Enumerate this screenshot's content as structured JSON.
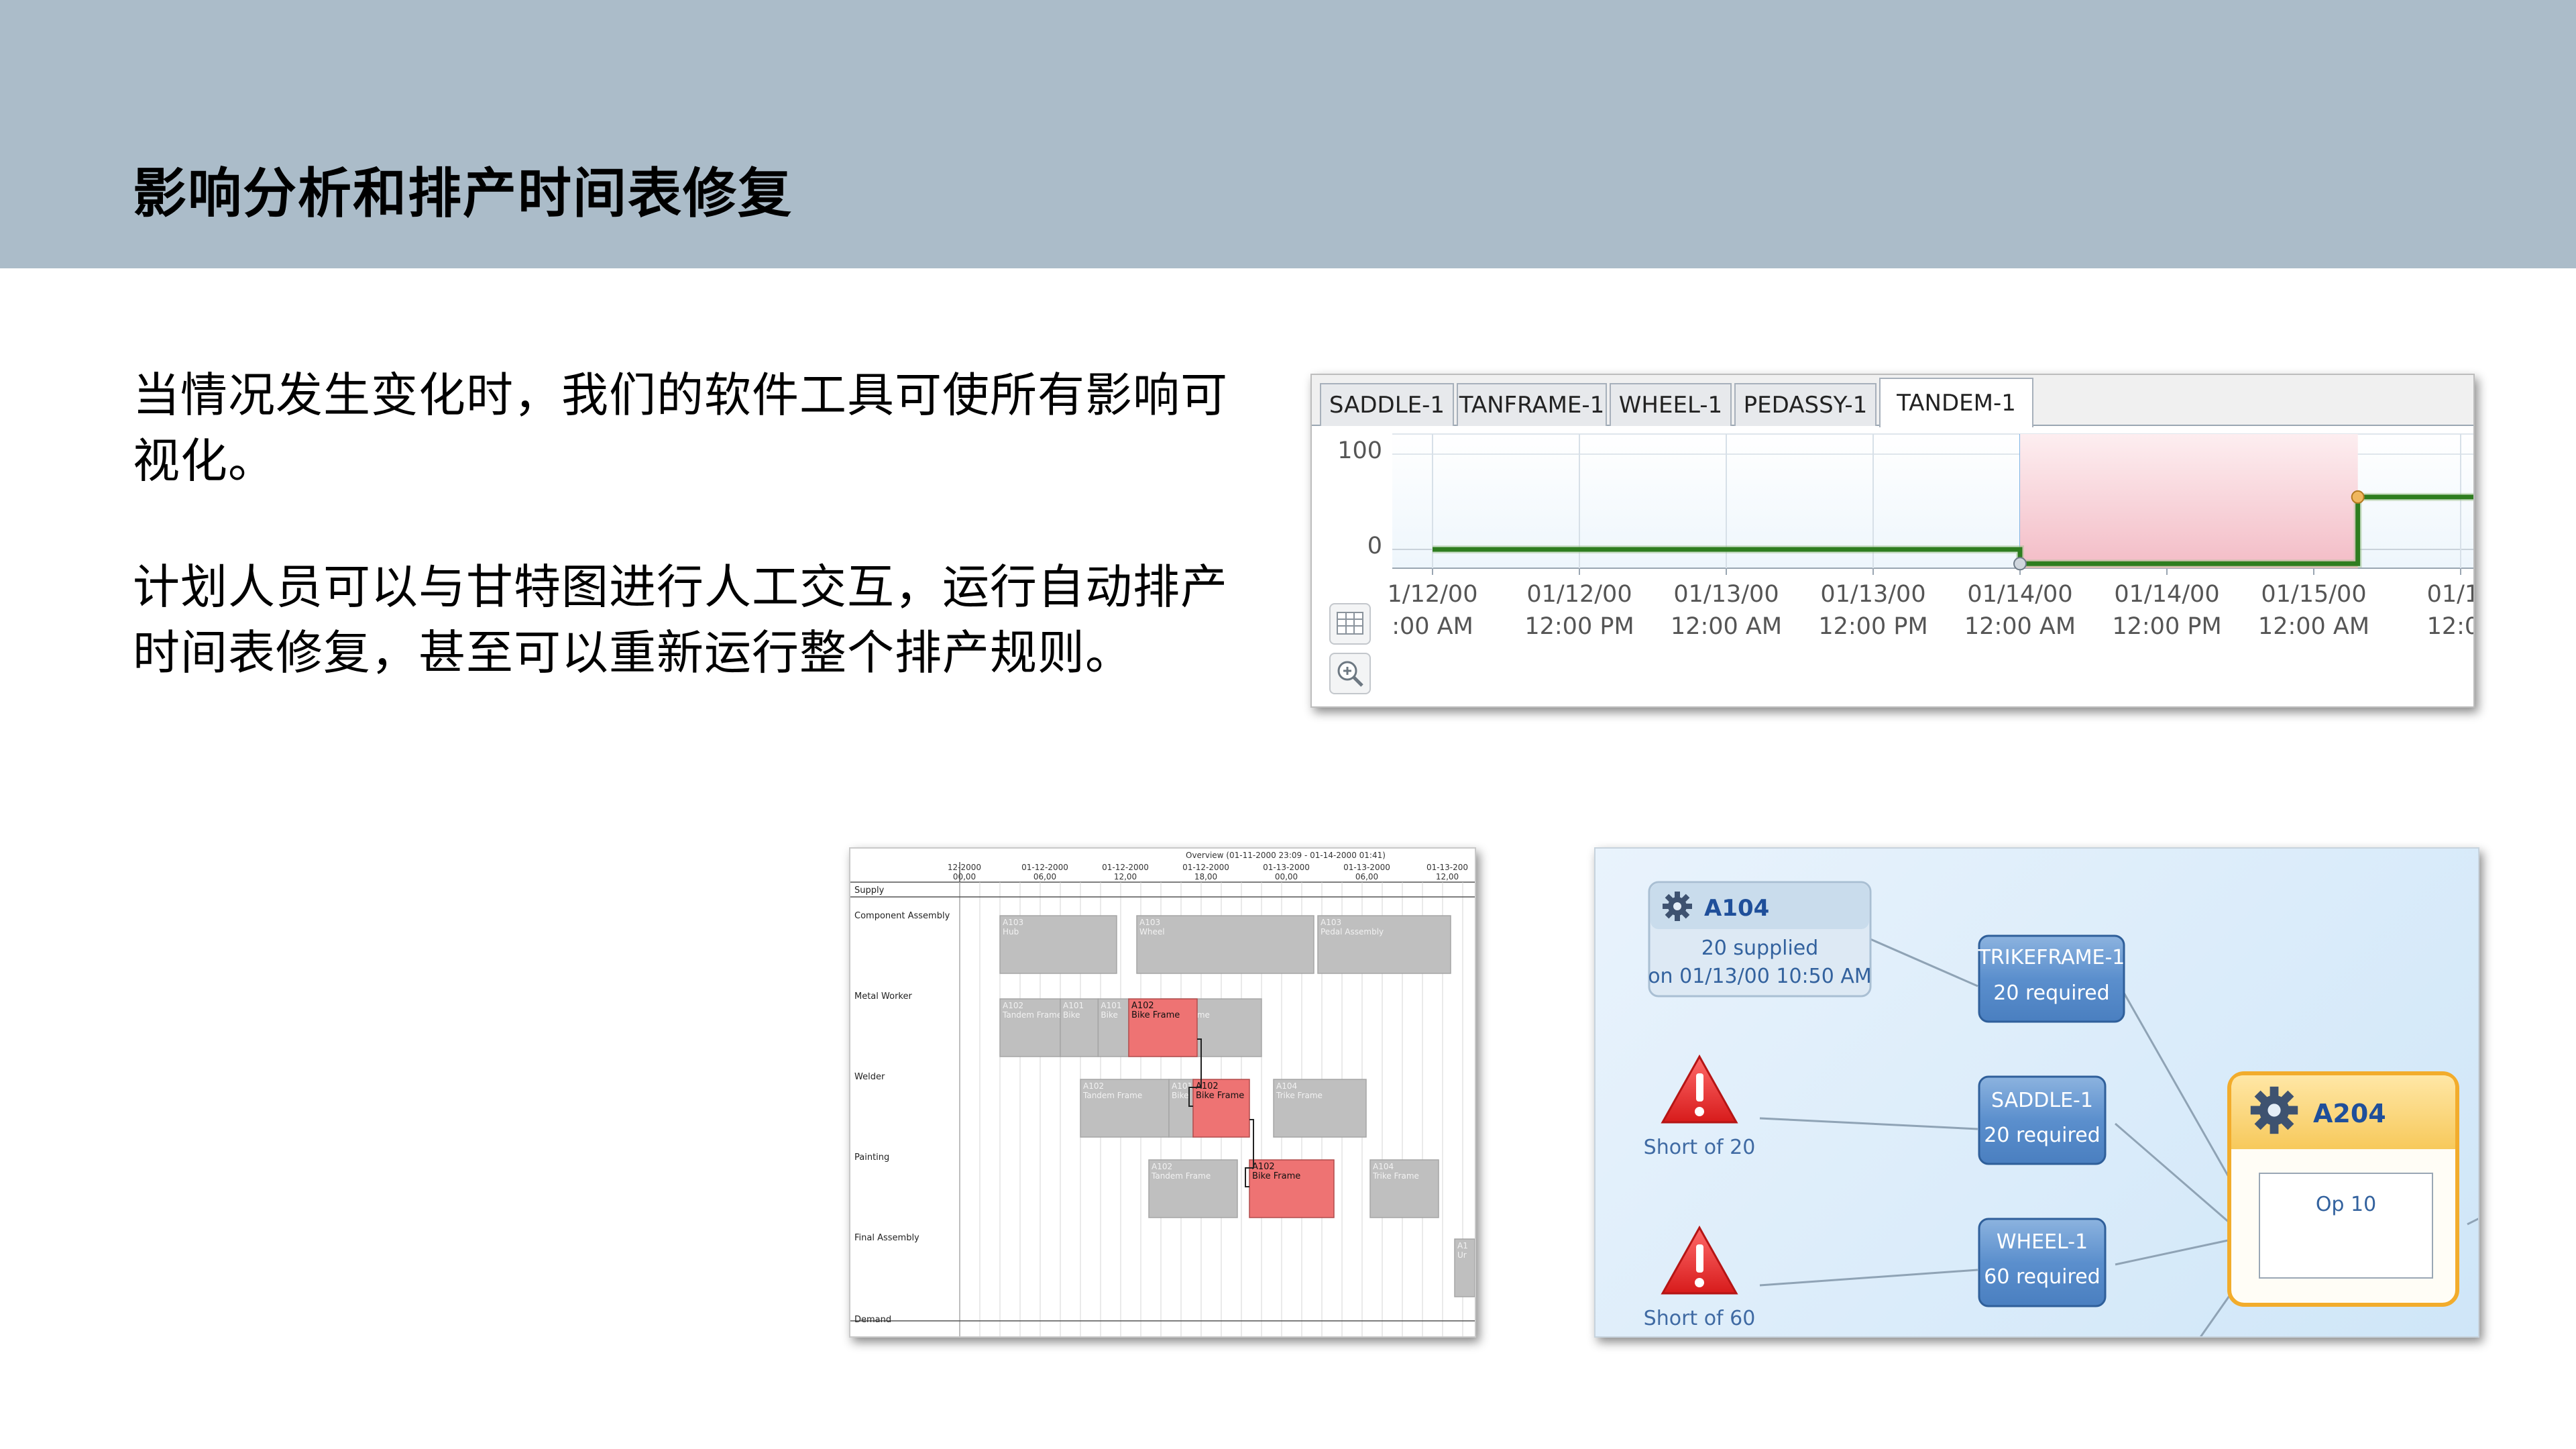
{
  "slide": {
    "title": "影响分析和排产时间表修复",
    "paragraph1_line1": "当情况发生变化时，我们的软件工具可使所有影响可",
    "paragraph1_line2": "视化。",
    "paragraph2_line1": "计划人员可以与甘特图进行人工交互，运行自动排产",
    "paragraph2_line2": "时间表修复，甚至可以重新运行整个排产规则。"
  },
  "inventory_panel": {
    "tabs": [
      {
        "label": "SADDLE-1",
        "active": false
      },
      {
        "label": "TANFRAME-1",
        "active": false
      },
      {
        "label": "WHEEL-1",
        "active": false
      },
      {
        "label": "PEDASSY-1",
        "active": false
      },
      {
        "label": "TANDEM-1",
        "active": true
      }
    ],
    "icons": {
      "table": "table-icon",
      "zoom": "zoom-icon"
    },
    "chart_data": {
      "type": "line",
      "y_ticks": [
        "100",
        "0"
      ],
      "x_ticks": [
        {
          "date": "1/12/00",
          "time": ":00 AM"
        },
        {
          "date": "01/12/00",
          "time": "12:00 PM"
        },
        {
          "date": "01/13/00",
          "time": "12:00 AM"
        },
        {
          "date": "01/13/00",
          "time": "12:00 PM"
        },
        {
          "date": "01/14/00",
          "time": "12:00 AM"
        },
        {
          "date": "01/14/00",
          "time": "12:00 PM"
        },
        {
          "date": "01/15/00",
          "time": "12:00 AM"
        },
        {
          "date": "01/15",
          "time": "12:00"
        }
      ],
      "series": [
        {
          "points": [
            [
              0,
              0
            ],
            [
              4,
              0
            ],
            [
              4,
              -15
            ],
            [
              6.3,
              -15
            ],
            [
              6.3,
              55
            ],
            [
              7.5,
              55
            ]
          ]
        }
      ],
      "shortage_region": [
        4,
        6.3
      ],
      "colors": {
        "line": "#2e7d1f",
        "shortage": "#f4c5cc",
        "marker": "#f0b75e"
      }
    }
  },
  "gantt_panel": {
    "overview_line1": "Overview   (01-11-2000 23:09 - 01-14-2000 01:41)",
    "axis_labels": [
      {
        "date": "12-2000",
        "time": "00,00"
      },
      {
        "date": "01-12-2000",
        "time": "06,00"
      },
      {
        "date": "01-12-2000",
        "time": "12,00"
      },
      {
        "date": "01-12-2000",
        "time": "18,00"
      },
      {
        "date": "01-13-2000",
        "time": "00,00"
      },
      {
        "date": "01-13-2000",
        "time": "06,00"
      },
      {
        "date": "01-13-200",
        "time": "12,00"
      }
    ],
    "lanes": [
      "Supply",
      "Component Assembly",
      "Metal Worker",
      "Welder",
      "Painting",
      "Final Assembly",
      "Demand"
    ],
    "bars": [
      {
        "lane": 1,
        "t0": 0.5,
        "t1": 1.95,
        "id": "A103",
        "label": "Hub"
      },
      {
        "lane": 1,
        "t0": 2.2,
        "t1": 4.4,
        "id": "A103",
        "label": "Wheel"
      },
      {
        "lane": 1,
        "t0": 4.45,
        "t1": 6.1,
        "id": "A103",
        "label": "Pedal Assembly"
      },
      {
        "lane": 2,
        "t0": 0.5,
        "t1": 1.25,
        "id": "A102",
        "label": "Tandem Frame"
      },
      {
        "lane": 2,
        "t0": 1.25,
        "t1": 1.72,
        "id": "A101",
        "label": "Bike"
      },
      {
        "lane": 2,
        "t0": 1.72,
        "t1": 2.1,
        "id": "A101",
        "label": "Bike"
      },
      {
        "lane": 2,
        "t0": 2.5,
        "t1": 3.75,
        "id": "A104",
        "label": "Trike Frame"
      },
      {
        "lane": 3,
        "t0": 1.5,
        "t1": 2.6,
        "id": "A102",
        "label": "Tandem Frame"
      },
      {
        "lane": 3,
        "t0": 2.6,
        "t1": 2.9,
        "id": "A101",
        "label": "Bike"
      },
      {
        "lane": 3,
        "t0": 3.9,
        "t1": 5.05,
        "id": "A104",
        "label": "Trike Frame"
      },
      {
        "lane": 4,
        "t0": 2.35,
        "t1": 3.45,
        "id": "A102",
        "label": "Tandem Frame"
      },
      {
        "lane": 4,
        "t0": 5.1,
        "t1": 5.95,
        "id": "A104",
        "label": "Trike Frame"
      },
      {
        "lane": 5,
        "t0": 6.15,
        "t1": 6.4,
        "id": "A1",
        "label": "Ur"
      }
    ],
    "highlight_bars": [
      {
        "lane": 2,
        "t0": 2.1,
        "t1": 2.95,
        "id": "A102",
        "label": "Bike Frame"
      },
      {
        "lane": 3,
        "t0": 2.9,
        "t1": 3.6,
        "id": "A102",
        "label": "Bike Frame"
      },
      {
        "lane": 4,
        "t0": 3.6,
        "t1": 4.65,
        "id": "A102",
        "label": "Bike Frame"
      }
    ]
  },
  "network_panel": {
    "supply_node": {
      "id": "A104",
      "line1": "20 supplied",
      "line2": "on 01/13/00 10:50 AM",
      "icon": "gear-icon"
    },
    "requirements": [
      {
        "name": "TRIKEFRAME-1",
        "qty": "20 required"
      },
      {
        "name": "SADDLE-1",
        "qty": "20 required"
      },
      {
        "name": "WHEEL-1",
        "qty": "60 required"
      }
    ],
    "shortages": [
      {
        "text": "Short of 20",
        "icon": "warning-icon"
      },
      {
        "text": "Short of 60",
        "icon": "warning-icon"
      }
    ],
    "operation_node": {
      "id": "A204",
      "op": "Op 10",
      "icon": "gear-icon"
    }
  }
}
